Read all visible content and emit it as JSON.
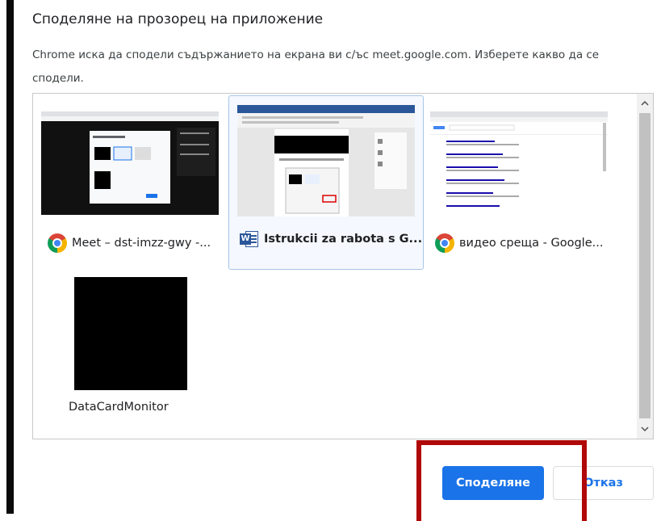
{
  "dialog": {
    "title": "Споделяне на прозорец на приложение",
    "description": "Chrome иска да сподели съдържанието на екрана ви с/ъс meet.google.com. Изберете какво да се сподели."
  },
  "windows": [
    {
      "label": "Meet – dst-imzz-gwy -...",
      "icon": "chrome-icon",
      "selected": false
    },
    {
      "label": "Istrukcii za rabota s G...",
      "icon": "word-icon",
      "selected": true
    },
    {
      "label": "видео среща - Google...",
      "icon": "chrome-icon",
      "selected": false
    },
    {
      "label": "DataCardMonitor",
      "icon": "none",
      "selected": false
    }
  ],
  "buttons": {
    "share": "Споделяне",
    "cancel": "Отказ"
  },
  "colors": {
    "accent": "#1a73e8",
    "highlight": "#b00808",
    "selected_border": "#a8c4e8"
  }
}
